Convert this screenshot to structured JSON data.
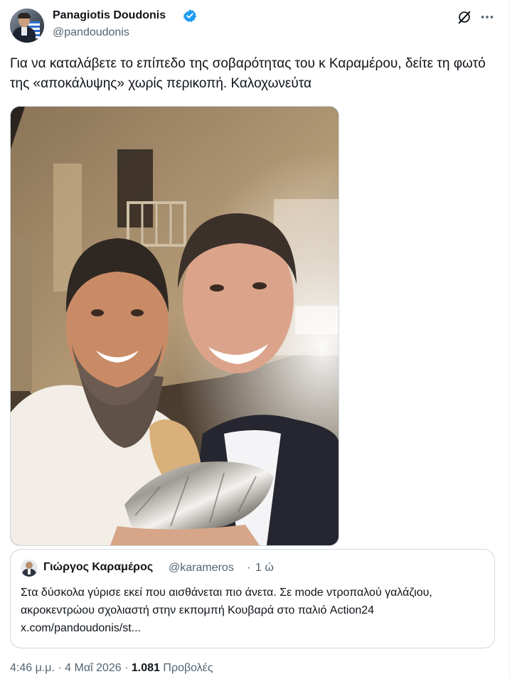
{
  "author": {
    "name": "Panagiotis Doudonis",
    "handle": "@pandoudonis"
  },
  "tweet": {
    "text": "Για να καταλάβετε το επίπεδο της σοβαρότητας του κ Καραμέρου, δείτε τη φωτό της «αποκάλυψης» χωρίς περικοπή. Καλοχωνεύτα"
  },
  "quoted": {
    "name": "Γιώργος Καραμέρος",
    "handle": "@karameros",
    "separator": "·",
    "time": "1 ώ",
    "text": "Στα δύσκολα γύρισε εκεί που αισθάνεται πιο άνετα. Σε mode ντροπαλού γαλάζιου, ακροκεντρώου σχολιαστή στην εκπομπή Κουβαρά στο παλιό Action24 x.com/pandoudonis/st..."
  },
  "meta": {
    "time": "4:46 μ.μ.",
    "sep1": "·",
    "date": "4 Μαΐ 2026",
    "sep2": "·",
    "views_count": "1.081",
    "views_label": "Προβολές"
  },
  "icons": {
    "verified": "verified-badge-icon",
    "grok": "grok-icon",
    "more": "more-icon"
  },
  "colors": {
    "verified": "#1d9bf0",
    "secondary_text": "#536471",
    "primary_text": "#0f1419",
    "border": "#cfd9de"
  }
}
